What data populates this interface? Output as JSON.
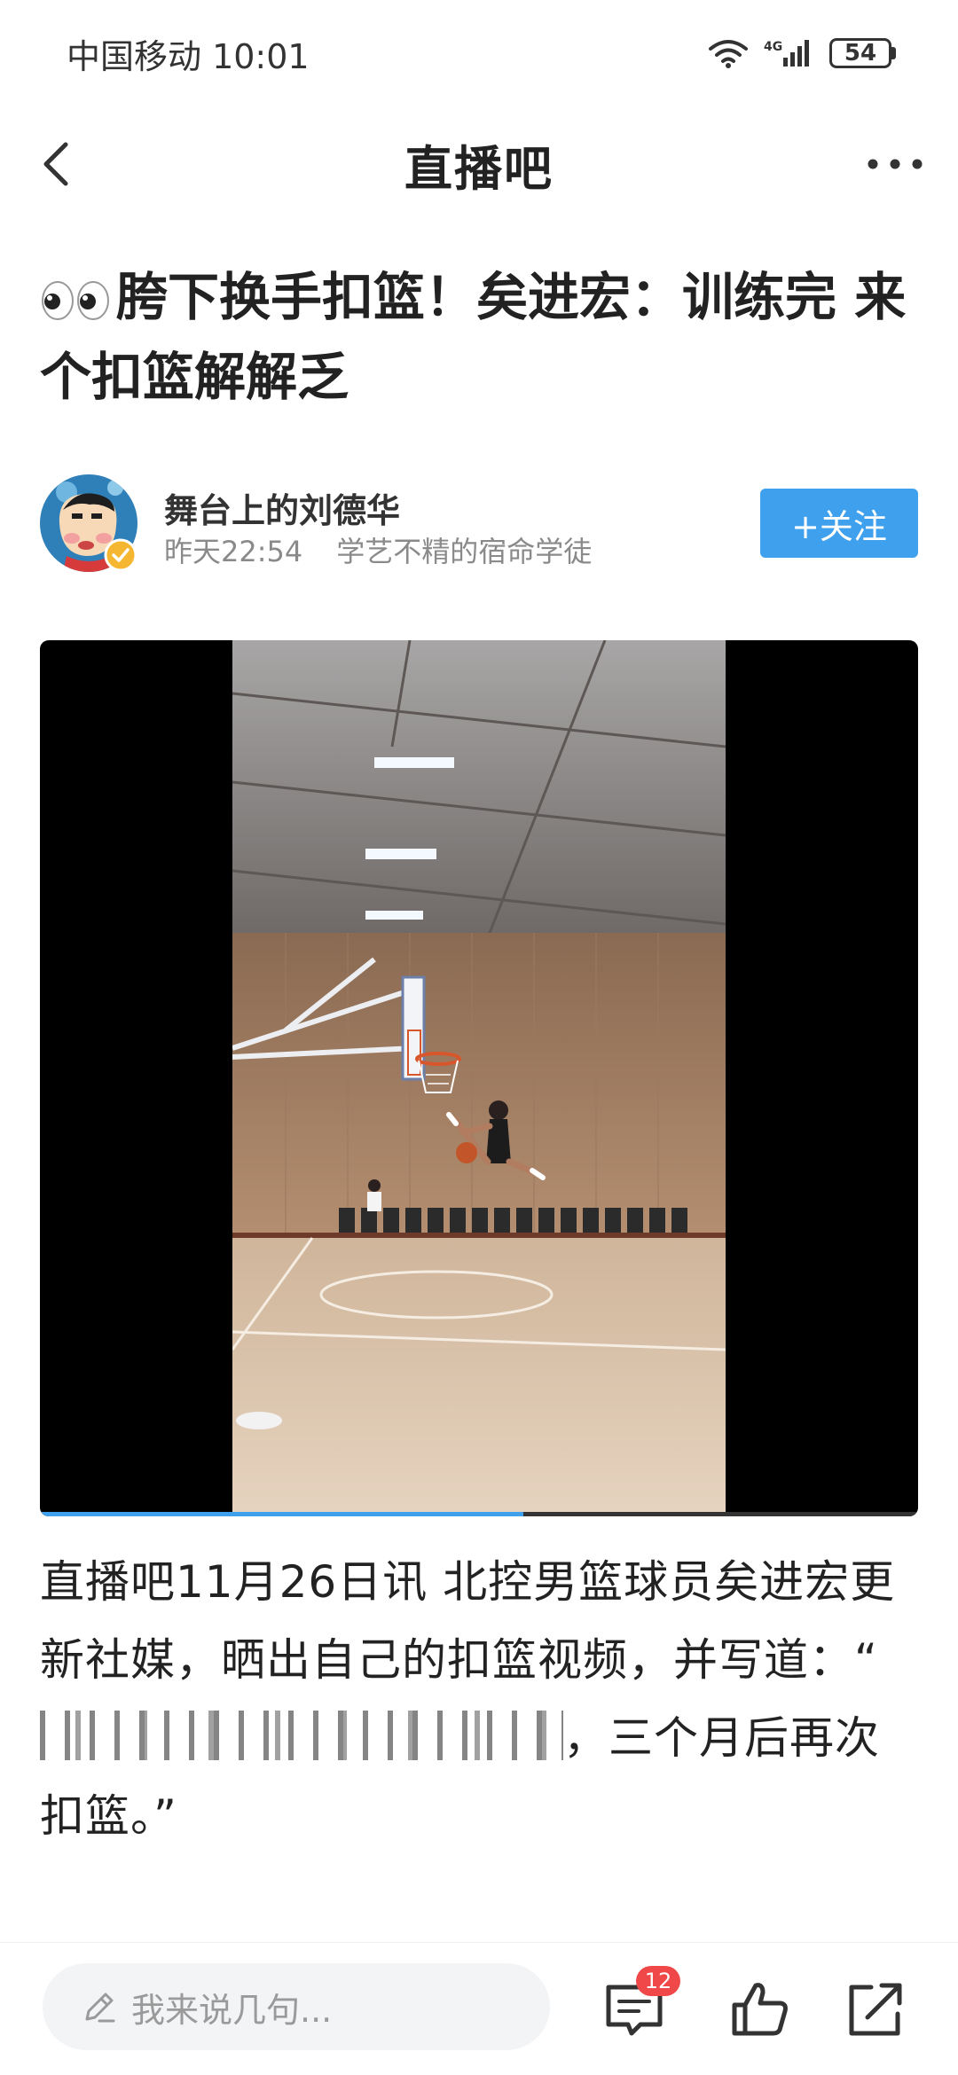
{
  "status_bar": {
    "carrier_time": "中国移动 10:01",
    "network": "4G",
    "battery": "54"
  },
  "nav": {
    "title": "直播吧",
    "back_icon": "back-chevron-icon",
    "more_icon": "more-dots-icon"
  },
  "article": {
    "title": "胯下换手扣篮！矣进宏：训练完 来个扣篮解解乏",
    "title_emoji": "eyes-emoji"
  },
  "author": {
    "name": "舞台上的刘德华",
    "time": "昨天22:54",
    "signature": "学艺不精的宿命学徒",
    "follow_label": "+关注"
  },
  "video": {
    "progress": 0.55
  },
  "body": {
    "text_before": "直播吧11月26日讯 北控男篮球员矣进宏更新社媒，晒出自己的扣篮视频，并写道：“",
    "text_after": "，三个月后再次扣篮。”"
  },
  "bottom_bar": {
    "comment_placeholder": "我来说几句...",
    "comment_count": "12"
  },
  "colors": {
    "accent": "#3fa0ee",
    "badge": "#f04848"
  }
}
